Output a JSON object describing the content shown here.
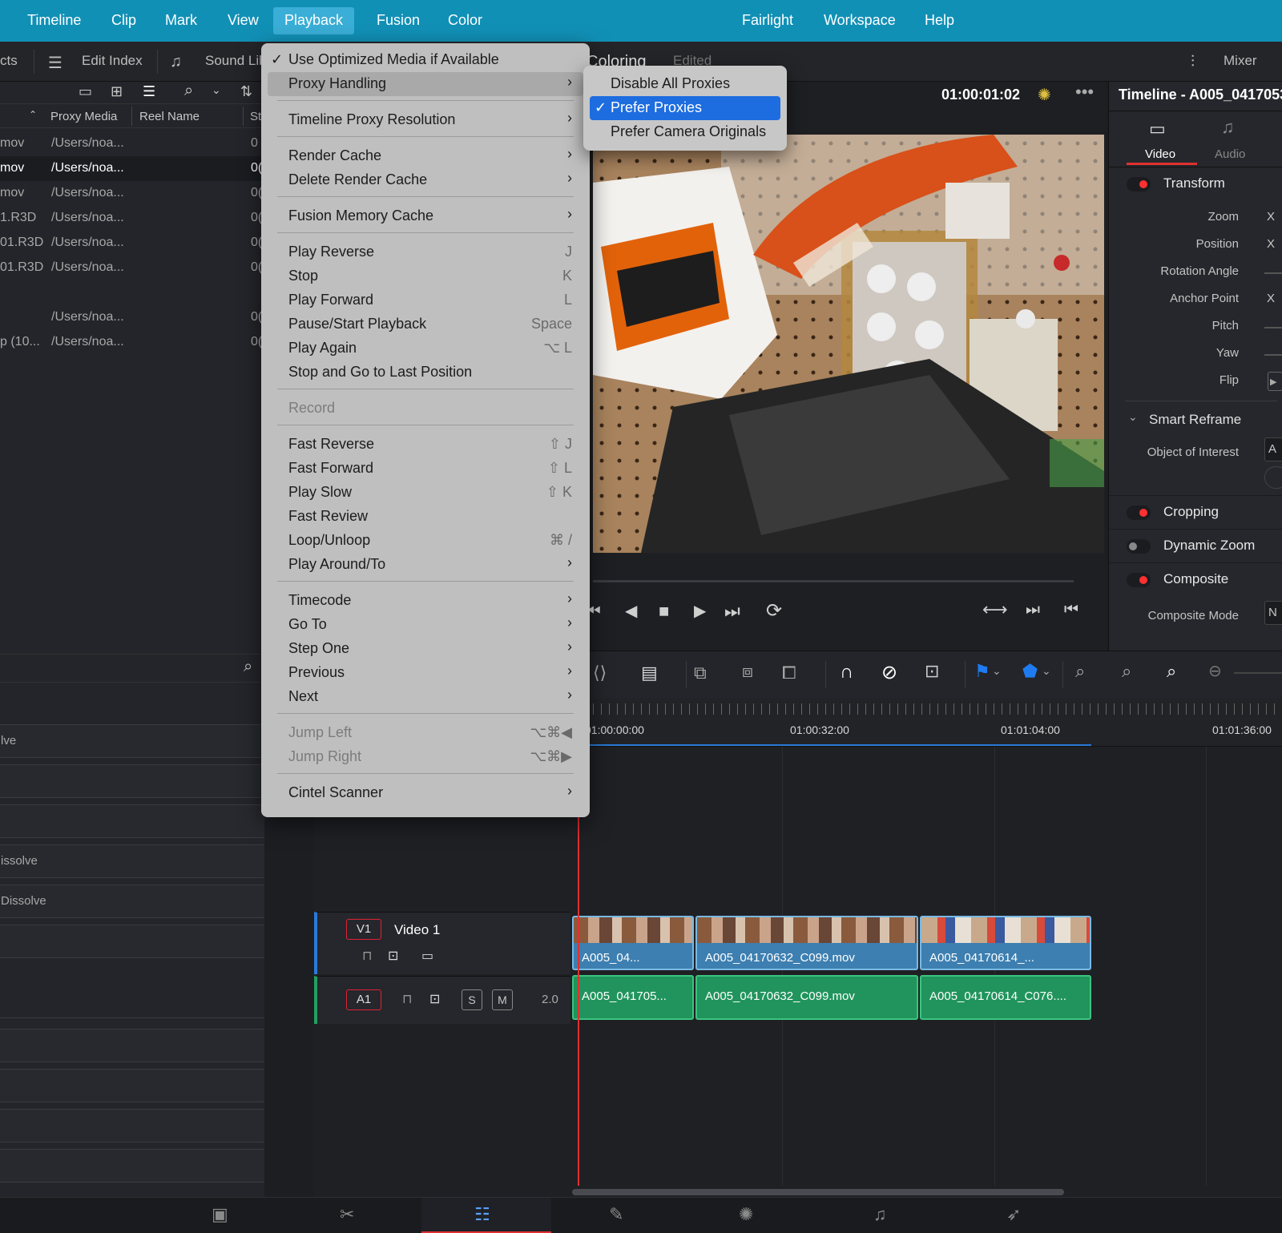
{
  "menubar": {
    "items": [
      "Timeline",
      "Clip",
      "Mark",
      "View",
      "Playback",
      "Fusion",
      "Color",
      "Fairlight",
      "Workspace",
      "Help"
    ],
    "active": "Playback"
  },
  "toolbar": {
    "left_tab_fragment": "cts",
    "edit_index": "Edit Index",
    "sound_library": "Sound Lib",
    "page_title": "Coloring",
    "page_status": "Edited",
    "mixer": "Mixer"
  },
  "media_pool": {
    "col_proxy": "Proxy Media",
    "col_reel": "Reel Name",
    "col_start": "St",
    "rows": [
      {
        "name": "mov",
        "proxy": "/Users/noa...",
        "start": "0"
      },
      {
        "name": "mov",
        "proxy": "/Users/noa...",
        "start": "0("
      },
      {
        "name": "mov",
        "proxy": "/Users/noa...",
        "start": "0("
      },
      {
        "name": "1.R3D",
        "proxy": "/Users/noa...",
        "start": "0("
      },
      {
        "name": "01.R3D",
        "proxy": "/Users/noa...",
        "start": "0("
      },
      {
        "name": "01.R3D",
        "proxy": "/Users/noa...",
        "start": "0("
      },
      {
        "name": "",
        "proxy": "/Users/noa...",
        "start": "0("
      },
      {
        "name": "p (10...",
        "proxy": "/Users/noa...",
        "start": "0("
      }
    ]
  },
  "effects_list": [
    "lve",
    "issolve",
    "Dissolve"
  ],
  "viewer": {
    "timecode": "01:00:01:02",
    "timeline_name": "Timeline - A005_0417053"
  },
  "inspector": {
    "tab_video": "Video",
    "tab_audio": "Audio",
    "transform": "Transform",
    "props": [
      "Zoom",
      "Position",
      "Rotation Angle",
      "Anchor Point",
      "Pitch",
      "Yaw",
      "Flip"
    ],
    "prop_values": [
      "X",
      "X",
      "",
      "X",
      "",
      "",
      ""
    ],
    "smart_reframe": "Smart Reframe",
    "object_of_interest": "Object of Interest",
    "object_value": "A",
    "cropping": "Cropping",
    "dynamic_zoom": "Dynamic Zoom",
    "composite": "Composite",
    "composite_mode": "Composite Mode",
    "composite_mode_value": "N"
  },
  "timeline": {
    "ruler": [
      "01:00:00:00",
      "01:00:32:00",
      "01:01:04:00",
      "01:01:36:00"
    ],
    "video_track": {
      "id": "V1",
      "name": "Video 1"
    },
    "audio_track": {
      "id": "A1",
      "level": "2.0",
      "solo": "S",
      "mute": "M"
    },
    "video_clips": [
      "A005_04...",
      "A005_04170632_C099.mov",
      "A005_04170614_..."
    ],
    "audio_clips": [
      "A005_041705...",
      "A005_04170632_C099.mov",
      "A005_04170614_C076...."
    ]
  },
  "playback_menu": {
    "items": [
      {
        "label": "Use Optimized Media if Available",
        "checked": true
      },
      {
        "label": "Proxy Handling",
        "submenu": true,
        "highlighted": true
      },
      {
        "label": "Timeline Proxy Resolution",
        "submenu": true
      },
      {
        "label": "Render Cache",
        "submenu": true
      },
      {
        "label": "Delete Render Cache",
        "submenu": true
      },
      {
        "label": "Fusion Memory Cache",
        "submenu": true
      },
      {
        "label": "Play Reverse",
        "shortcut": "J"
      },
      {
        "label": "Stop",
        "shortcut": "K"
      },
      {
        "label": "Play Forward",
        "shortcut": "L"
      },
      {
        "label": "Pause/Start Playback",
        "shortcut": "Space"
      },
      {
        "label": "Play Again",
        "shortcut": "⌥ L"
      },
      {
        "label": "Stop and Go to Last Position"
      },
      {
        "label": "Record",
        "disabled": true
      },
      {
        "label": "Fast Reverse",
        "shortcut": "⇧ J"
      },
      {
        "label": "Fast Forward",
        "shortcut": "⇧ L"
      },
      {
        "label": "Play Slow",
        "shortcut": "⇧ K"
      },
      {
        "label": "Fast Review"
      },
      {
        "label": "Loop/Unloop",
        "shortcut": "⌘ /"
      },
      {
        "label": "Play Around/To",
        "submenu": true
      },
      {
        "label": "Timecode",
        "submenu": true
      },
      {
        "label": "Go To",
        "submenu": true
      },
      {
        "label": "Step One",
        "submenu": true
      },
      {
        "label": "Previous",
        "submenu": true
      },
      {
        "label": "Next",
        "submenu": true
      },
      {
        "label": "Jump Left",
        "shortcut": "⌥⌘◀",
        "disabled": true
      },
      {
        "label": "Jump Right",
        "shortcut": "⌥⌘▶",
        "disabled": true
      },
      {
        "label": "Cintel Scanner",
        "submenu": true
      }
    ]
  },
  "proxy_submenu": {
    "items": [
      {
        "label": "Disable All Proxies"
      },
      {
        "label": "Prefer Proxies",
        "checked": true,
        "highlighted": true
      },
      {
        "label": "Prefer Camera Originals"
      }
    ]
  },
  "colors": {
    "menubar": "#1190b6",
    "highlight_blue": "#1d6de0",
    "video_clip": "#3d7fb0",
    "audio_clip": "#20945c",
    "playhead": "#e03030"
  }
}
